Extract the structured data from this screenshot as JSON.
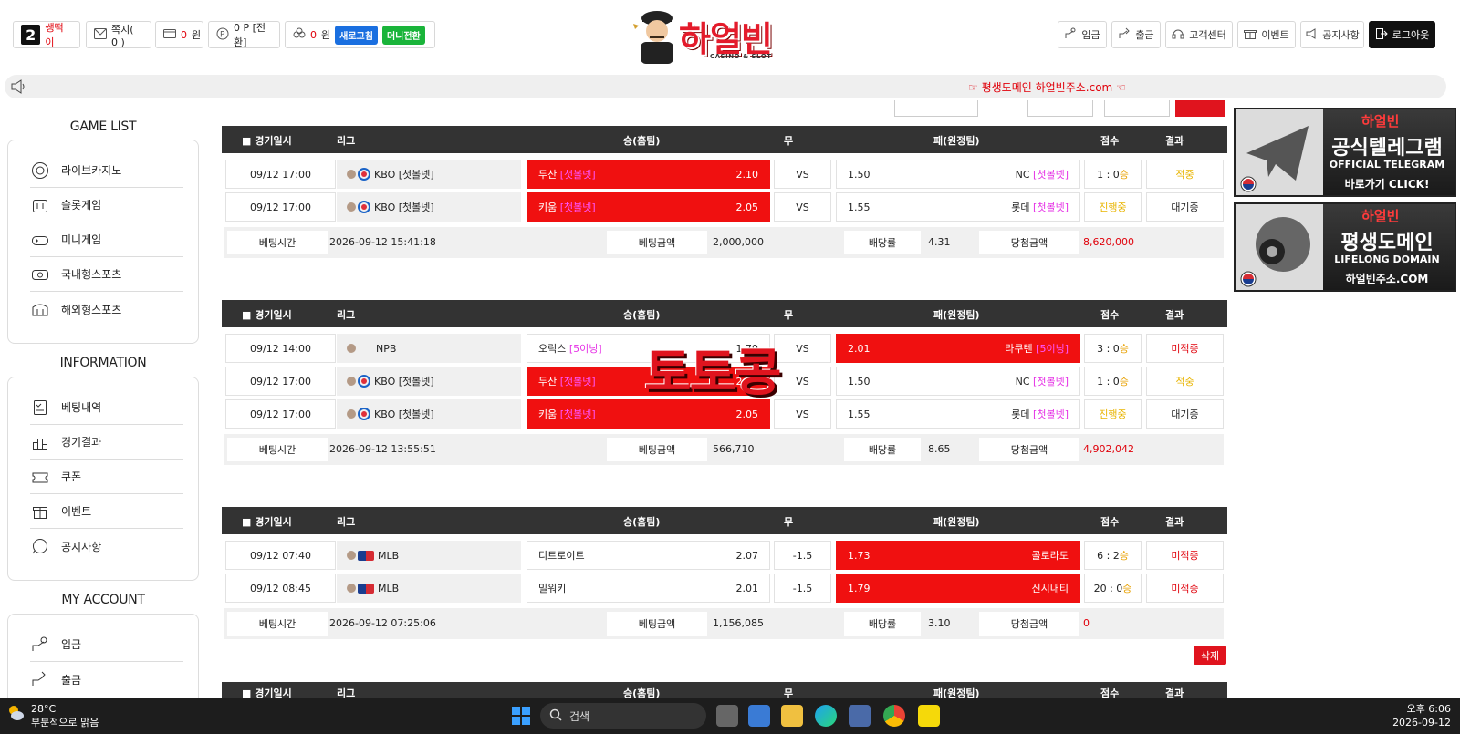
{
  "header": {
    "level": "2",
    "username": "쌩떡이",
    "message_label": "쪽지( 0 )",
    "cash_value": "0",
    "cash_unit": "원",
    "point_label": "0 P [전환]",
    "casino_value": "0",
    "casino_unit": "원",
    "refresh_label": "새로고침",
    "mini_convert_label": "머니전환",
    "logo_text": "하얼빈",
    "logo_sub": "CASINO & SLOT",
    "right_buttons": [
      "입금",
      "출금",
      "고객센터",
      "이벤트",
      "공지사항",
      "로그아웃"
    ]
  },
  "notice": {
    "text": "☞ 평생도메인 하얼빈주소.com ☜"
  },
  "sidebar": {
    "game_list_title": "GAME LIST",
    "game_list": [
      "라이브카지노",
      "슬롯게임",
      "미니게임",
      "국내형스포츠",
      "해외형스포츠"
    ],
    "information_title": "INFORMATION",
    "information": [
      "베팅내역",
      "경기결과",
      "쿠폰",
      "이벤트",
      "공지사항"
    ],
    "account_title": "MY ACCOUNT",
    "account": [
      "입금",
      "출금"
    ]
  },
  "table_headers": [
    "경기일시",
    "리그",
    "승(홈팀)",
    "무",
    "패(원정팀)",
    "점수",
    "결과"
  ],
  "summary_labels": {
    "time": "베팅시간",
    "amount": "베팅금액",
    "odds": "배당률",
    "win": "당첨금액"
  },
  "bets": [
    {
      "rows": [
        {
          "date": "09/12 17:00",
          "league": "KBO [첫볼넷]",
          "home": "두산",
          "home_tag": "[첫볼넷]",
          "home_odds": "2.10",
          "draw": "VS",
          "away_odds": "1.50",
          "away": "NC",
          "away_tag": "[첫볼넷]",
          "score": "1 : 0",
          "score_suffix": "승",
          "result": "적중",
          "pick": "home"
        },
        {
          "date": "09/12 17:00",
          "league": "KBO [첫볼넷]",
          "home": "키움",
          "home_tag": "[첫볼넷]",
          "home_odds": "2.05",
          "draw": "VS",
          "away_odds": "1.55",
          "away": "롯데",
          "away_tag": "[첫볼넷]",
          "score": "진행중",
          "score_suffix": "",
          "result": "대기중",
          "pick": "home"
        }
      ],
      "time": "2026-09-12 15:41:18",
      "amount": "2,000,000",
      "odds": "4.31",
      "win": "8,620,000"
    },
    {
      "rows": [
        {
          "date": "09/12 14:00",
          "league": "NPB",
          "home": "오릭스",
          "home_tag": "[5이닝]",
          "home_odds": "1.79",
          "draw": "VS",
          "away_odds": "2.01",
          "away": "라쿠텐",
          "away_tag": "[5이닝]",
          "score": "3 : 0",
          "score_suffix": "승",
          "result": "미적중",
          "pick": "away"
        },
        {
          "date": "09/12 17:00",
          "league": "KBO [첫볼넷]",
          "home": "두산",
          "home_tag": "[첫볼넷]",
          "home_odds": "2.10",
          "draw": "VS",
          "away_odds": "1.50",
          "away": "NC",
          "away_tag": "[첫볼넷]",
          "score": "1 : 0",
          "score_suffix": "승",
          "result": "적중",
          "pick": "home"
        },
        {
          "date": "09/12 17:00",
          "league": "KBO [첫볼넷]",
          "home": "키움",
          "home_tag": "[첫볼넷]",
          "home_odds": "2.05",
          "draw": "VS",
          "away_odds": "1.55",
          "away": "롯데",
          "away_tag": "[첫볼넷]",
          "score": "진행중",
          "score_suffix": "",
          "result": "대기중",
          "pick": "home"
        }
      ],
      "time": "2026-09-12 13:55:51",
      "amount": "566,710",
      "odds": "8.65",
      "win": "4,902,042"
    },
    {
      "rows": [
        {
          "date": "09/12 07:40",
          "league": "MLB",
          "home": "디트로이트",
          "home_tag": "",
          "home_odds": "2.07",
          "draw": "-1.5",
          "away_odds": "1.73",
          "away": "콜로라도",
          "away_tag": "",
          "score": "6 : 2",
          "score_suffix": "승",
          "result": "미적중",
          "pick": "away"
        },
        {
          "date": "09/12 08:45",
          "league": "MLB",
          "home": "밀워키",
          "home_tag": "",
          "home_odds": "2.01",
          "draw": "-1.5",
          "away_odds": "1.79",
          "away": "신시내티",
          "away_tag": "",
          "score": "20 : 0",
          "score_suffix": "승",
          "result": "미적중",
          "pick": "away"
        }
      ],
      "time": "2026-09-12 07:25:06",
      "amount": "1,156,085",
      "odds": "3.10",
      "win": "0"
    }
  ],
  "delete_label": "삭제",
  "banners": [
    {
      "logo": "하얼빈",
      "title": "공식텔레그램",
      "sub": "OFFICIAL TELEGRAM",
      "foot": "바로가기 CLICK!"
    },
    {
      "logo": "하얼빈",
      "title": "평생도메인",
      "sub": "LIFELONG DOMAIN",
      "foot": "하얼빈주소.COM"
    }
  ],
  "watermark": "토토콩",
  "taskbar": {
    "temp": "28°C",
    "weather": "부분적으로 맑음",
    "search_placeholder": "검색",
    "time": "오후 6:06",
    "date": "2026-09-12"
  },
  "colors": {
    "accent_red": "#f01010",
    "header_dark": "#333333",
    "win_yellow": "#e8b400",
    "tag_magenta": "#e632e6"
  }
}
